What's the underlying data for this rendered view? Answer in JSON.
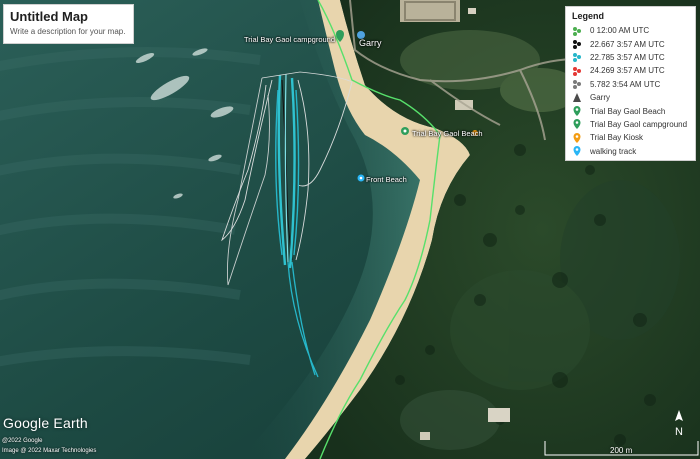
{
  "title_panel": {
    "title": "Untitled Map",
    "description": "Write a description for your map."
  },
  "legend": {
    "heading": "Legend",
    "items": [
      {
        "label": "0 12:00 AM UTC",
        "icon": "track-icon",
        "color": "#4caf50"
      },
      {
        "label": "22.667 3:57 AM UTC",
        "icon": "track-icon",
        "color": "#111111"
      },
      {
        "label": "22.785 3:57 AM UTC",
        "icon": "track-icon",
        "color": "#26b6c9"
      },
      {
        "label": "24.269 3:57 AM UTC",
        "icon": "track-icon",
        "color": "#e53935"
      },
      {
        "label": "5.782 3:54 AM UTC",
        "icon": "track-icon",
        "color": "#7a7a7a"
      },
      {
        "label": "Garry",
        "icon": "person-icon",
        "color": "#4a4a4a"
      },
      {
        "label": "Trial Bay Gaol Beach",
        "icon": "pin-icon",
        "color": "#2e9e5b"
      },
      {
        "label": "Trial Bay Gaol campground",
        "icon": "pin-icon",
        "color": "#2e9e5b"
      },
      {
        "label": "Trial Bay Kiosk",
        "icon": "pin-icon",
        "color": "#f39c12"
      },
      {
        "label": "walking track",
        "icon": "pin-icon",
        "color": "#29b6f6"
      }
    ]
  },
  "places": {
    "campground": "Trial Bay Gaol campground",
    "garry": "Garry",
    "beach": "Trial Bay Gaol Beach",
    "front_beach": "Front Beach",
    "cut_label": "Trial Bay Kiosk"
  },
  "branding": {
    "name": "Google Earth",
    "credit1": "@2022 Google",
    "credit2": "Image @ 2022 Maxar Technologies"
  },
  "scale": {
    "label": "200 m"
  },
  "north": {
    "label": "N"
  },
  "colors": {
    "sea": "#1f4a44",
    "sand": "#e6d3ad",
    "forest": "#1f3a23",
    "track": "#26b6c9",
    "path": "#4cd964"
  }
}
